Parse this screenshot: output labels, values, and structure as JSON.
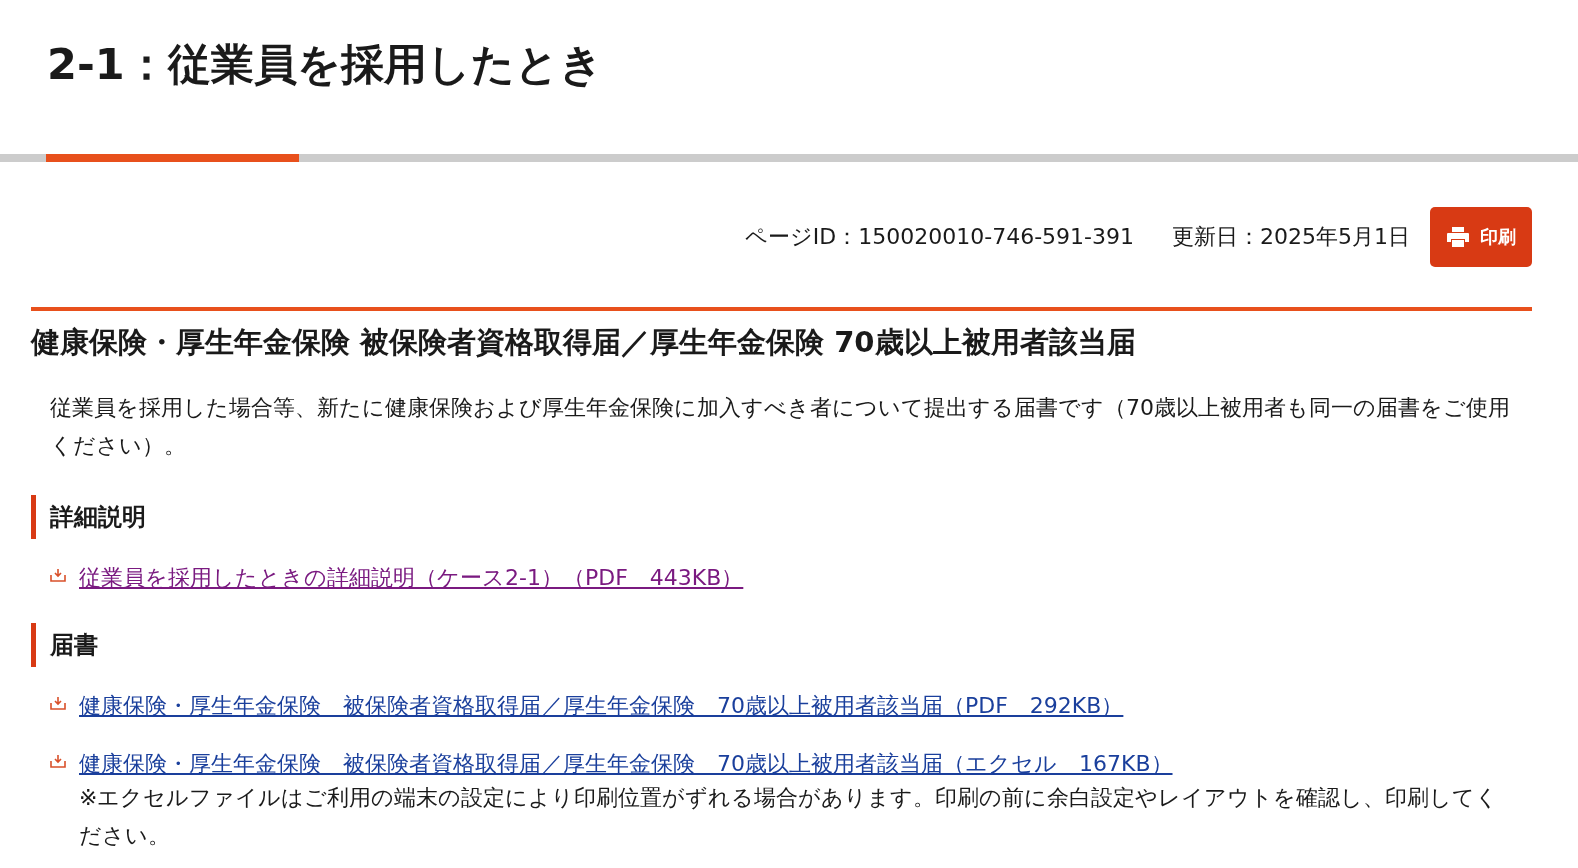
{
  "page_title": "2-1：従業員を採用したとき",
  "meta": {
    "page_id": "ページID：150020010-746-591-391",
    "updated": "更新日：2025年5月1日",
    "print_button": "印刷"
  },
  "section": {
    "heading": "健康保険・厚生年金保険 被保険者資格取得届／厚生年金保険 70歳以上被用者該当届",
    "intro": "従業員を採用した場合等、新たに健康保険および厚生年金保険に加入すべき者について提出する届書です（70歳以上被用者も同一の届書をご使用ください）。",
    "subsections": [
      {
        "heading": "詳細説明",
        "links": [
          {
            "text": "従業員を採用したときの詳細説明（ケース2-1）（PDF　443KB）",
            "visited": true
          }
        ]
      },
      {
        "heading": "届書",
        "links": [
          {
            "text": "健康保険・厚生年金保険　被保険者資格取得届／厚生年金保険　70歳以上被用者該当届（PDF　292KB）",
            "visited": false
          },
          {
            "text": "健康保険・厚生年金保険　被保険者資格取得届／厚生年金保険　70歳以上被用者該当届（エクセル　167KB）",
            "visited": false,
            "note": "※エクセルファイルはご利用の端末の設定により印刷位置がずれる場合があります。印刷の前に余白設定やレイアウトを確認し、印刷してください。"
          }
        ]
      }
    ]
  }
}
